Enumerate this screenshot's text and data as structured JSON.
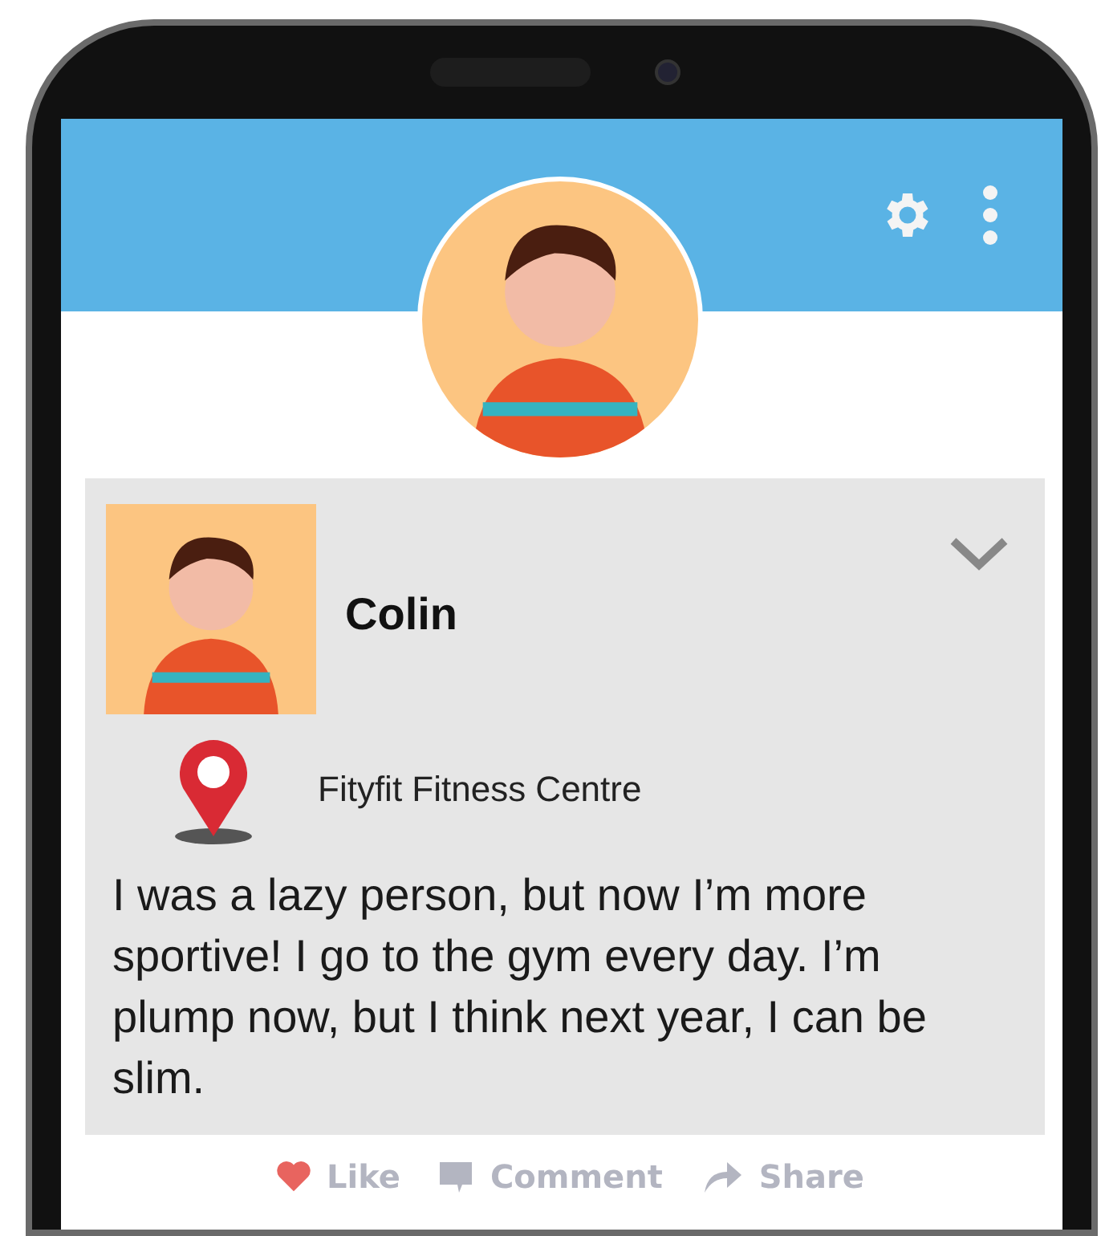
{
  "post": {
    "author": "Colin",
    "location": "Fityfit Fitness Centre",
    "text": "I was a lazy person, but now I’m more sportive! I go to the gym every day. I’m plump now, but I think next year, I can be slim."
  },
  "actions": [
    {
      "kind": "like",
      "label": "Like",
      "selected": true
    },
    {
      "kind": "comment",
      "label": "Comment",
      "selected": false
    },
    {
      "kind": "share",
      "label": "Share",
      "selected": false
    }
  ]
}
